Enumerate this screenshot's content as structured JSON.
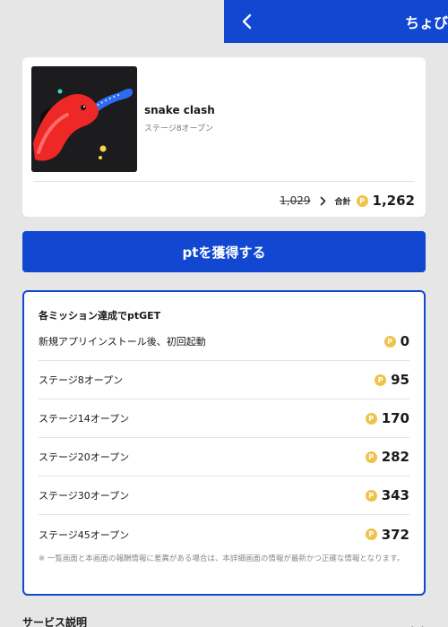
{
  "header": {
    "title": "ちょび"
  },
  "app": {
    "name": "snake clash",
    "subtitle": "ステージ8オープン"
  },
  "price": {
    "old": "1,029",
    "total_label": "合計",
    "total": "1,262"
  },
  "cta": {
    "label": "ptを獲得する"
  },
  "coin_symbol": "P",
  "colors": {
    "brand_blue": "#1147d1",
    "coin_gold": "#f0c24a",
    "background": "#e6e6e6"
  },
  "missions": {
    "title": "各ミッション達成でptGET",
    "items": [
      {
        "label": "新規アプリインストール後、初回起動",
        "points": "0"
      },
      {
        "label": "ステージ8オープン",
        "points": "95"
      },
      {
        "label": "ステージ14オープン",
        "points": "170"
      },
      {
        "label": "ステージ20オープン",
        "points": "282"
      },
      {
        "label": "ステージ30オープン",
        "points": "343"
      },
      {
        "label": "ステージ45オープン",
        "points": "372"
      }
    ],
    "note": "※ 一覧画面と本画面の報酬情報に差異がある場合は、本詳細画面の情報が最新かつ正確な情報となります。"
  },
  "service": {
    "label": "サービス説明"
  },
  "icons": {
    "back": "chevron-left-icon",
    "arrow": "chevron-right-icon",
    "expand": "chevron-down-icon",
    "coin": "point-coin-icon"
  }
}
